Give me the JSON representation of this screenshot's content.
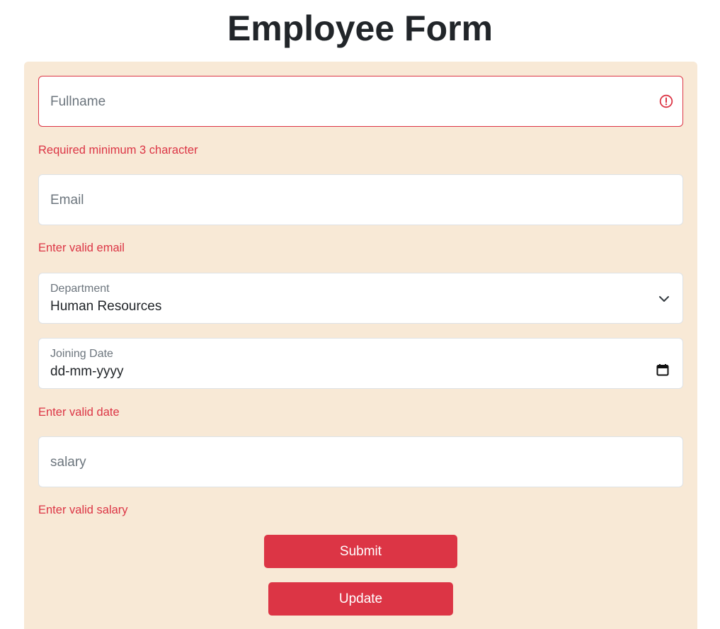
{
  "page": {
    "title": "Employee Form"
  },
  "form": {
    "fullname": {
      "placeholder": "Fullname",
      "error": "Required minimum 3 character"
    },
    "email": {
      "placeholder": "Email",
      "error": "Enter valid email"
    },
    "department": {
      "label": "Department",
      "selected": "Human Resources"
    },
    "joining_date": {
      "label": "Joining Date",
      "value": "dd-mm-yyyy",
      "error": "Enter valid date"
    },
    "salary": {
      "placeholder": "salary",
      "error": "Enter valid salary"
    },
    "buttons": {
      "submit": "Submit",
      "update": "Update"
    }
  },
  "colors": {
    "card_background": "#f8e9d6",
    "danger": "#dc3545",
    "text": "#212529",
    "muted": "#6c757d"
  },
  "icons": {
    "fullname_status": "alert-circle-icon",
    "department_toggle": "chevron-down-icon",
    "date_picker": "calendar-icon"
  }
}
